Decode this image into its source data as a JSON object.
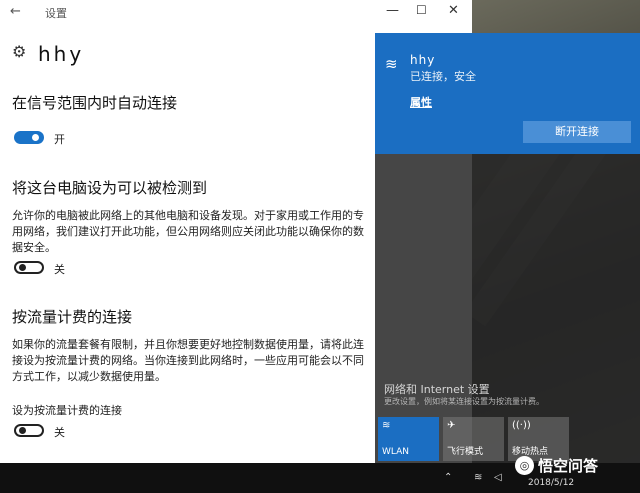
{
  "window": {
    "back_icon": "back-arrow-icon",
    "title": "设置",
    "controls": {
      "minimize": "—",
      "maximize": "☐",
      "close": "✕"
    }
  },
  "page": {
    "icon": "gear-icon",
    "title": "hhy"
  },
  "auto_connect": {
    "heading": "在信号范围内时自动连接",
    "toggle_on": true,
    "toggle_label": "开"
  },
  "discoverable": {
    "heading": "将这台电脑设为可以被检测到",
    "description": "允许你的电脑被此网络上的其他电脑和设备发现。对于家用或工作用的专用网络，我们建议打开此功能，但公用网络则应关闭此功能以确保你的数据安全。",
    "toggle_on": false,
    "toggle_label": "关"
  },
  "metered": {
    "heading": "按流量计费的连接",
    "description": "如果你的流量套餐有限制，并且你想要更好地控制数据使用量，请将此连接设为按流量计费的网络。当你连接到此网络时，一些应用可能会以不同方式工作，以减少数据使用量。",
    "setting_label": "设为按流量计费的连接",
    "toggle_on": false,
    "toggle_label": "关"
  },
  "cut_off_heading": "属性",
  "network_flyout": {
    "wifi_icon": "wifi-icon",
    "network_name": "hhy",
    "status": "已连接，安全",
    "properties_link": "属性",
    "disconnect_button": "断开连接",
    "settings_link": "网络和 Internet 设置",
    "settings_sub": "更改设置，例如将某连接设置为按流量计费。",
    "tiles": [
      {
        "label": "WLAN",
        "icon": "wifi-icon",
        "active": true
      },
      {
        "label": "飞行模式",
        "icon": "airplane-icon",
        "active": false
      },
      {
        "label": "移动热点",
        "icon": "hotspot-icon",
        "active": false
      }
    ]
  },
  "taskbar": {
    "date": "2018/5/12",
    "tray_icons": [
      "chevron-up-icon",
      "network-icon",
      "volume-icon"
    ]
  },
  "watermark": {
    "text": "悟空问答"
  },
  "colors": {
    "accent": "#1b6ec2",
    "toggle_on": "#1a73c8",
    "window_bg": "#ffffff",
    "flyout_bg": "#282828"
  }
}
